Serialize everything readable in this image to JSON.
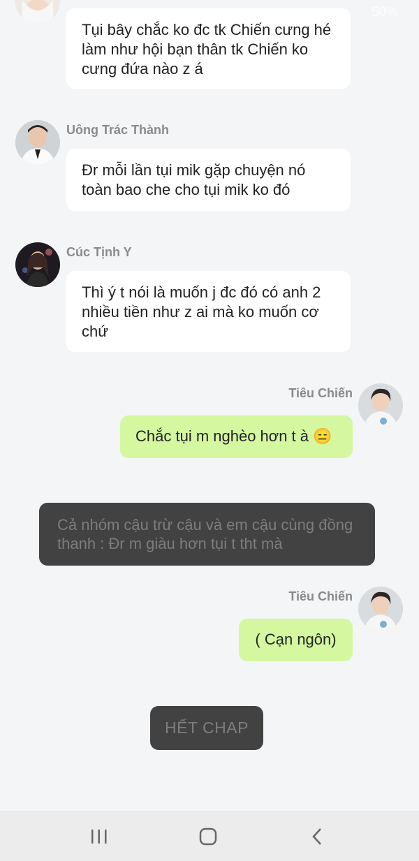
{
  "status_bar": {
    "battery": "50%",
    "icons": [
      "wifi-icon",
      "battery-icon"
    ]
  },
  "messages": [
    {
      "side": "left",
      "sender": "",
      "avatar": "avatar-girl",
      "text": "Tụi bây chắc ko đc tk Chiến cưng hé làm như hội bạn thân tk Chiến ko cưng đứa nào z á"
    },
    {
      "side": "left",
      "sender": "Uông Trác Thành",
      "avatar": "avatar-thanh",
      "text": "Đr mỗi lần tụi mik gặp chuyện nó toàn bao che cho tụi mik ko đó"
    },
    {
      "side": "left",
      "sender": "Cúc Tịnh Y",
      "avatar": "avatar-y",
      "text": "Thì ý t nói là muốn j đc đó có anh 2 nhiều tiền như z ai mà ko muốn cơ chứ"
    },
    {
      "side": "right",
      "sender": "Tiêu Chiến",
      "avatar": "avatar-chien",
      "text": "Chắc tụi m nghèo hơn t à 😑"
    },
    {
      "side": "right",
      "sender": "Tiêu Chiến",
      "avatar": "avatar-chien",
      "text": "( Cạn ngôn)"
    }
  ],
  "narration": "Cả nhóm cậu trừ cậu và em cậu cùng đồng thanh : Đr m giàu hơn tụi t tht mà",
  "end_button": "HẾT CHAP",
  "nav": {
    "icons": [
      "recent-apps-icon",
      "home-icon",
      "back-icon"
    ]
  },
  "colors": {
    "background": "#f4f5f7",
    "bubble_left": "#ffffff",
    "bubble_right": "#d4f7a0",
    "narration_bg": "#424242",
    "narration_text": "#7d7d7d",
    "sender_name": "#8a8a8a"
  }
}
